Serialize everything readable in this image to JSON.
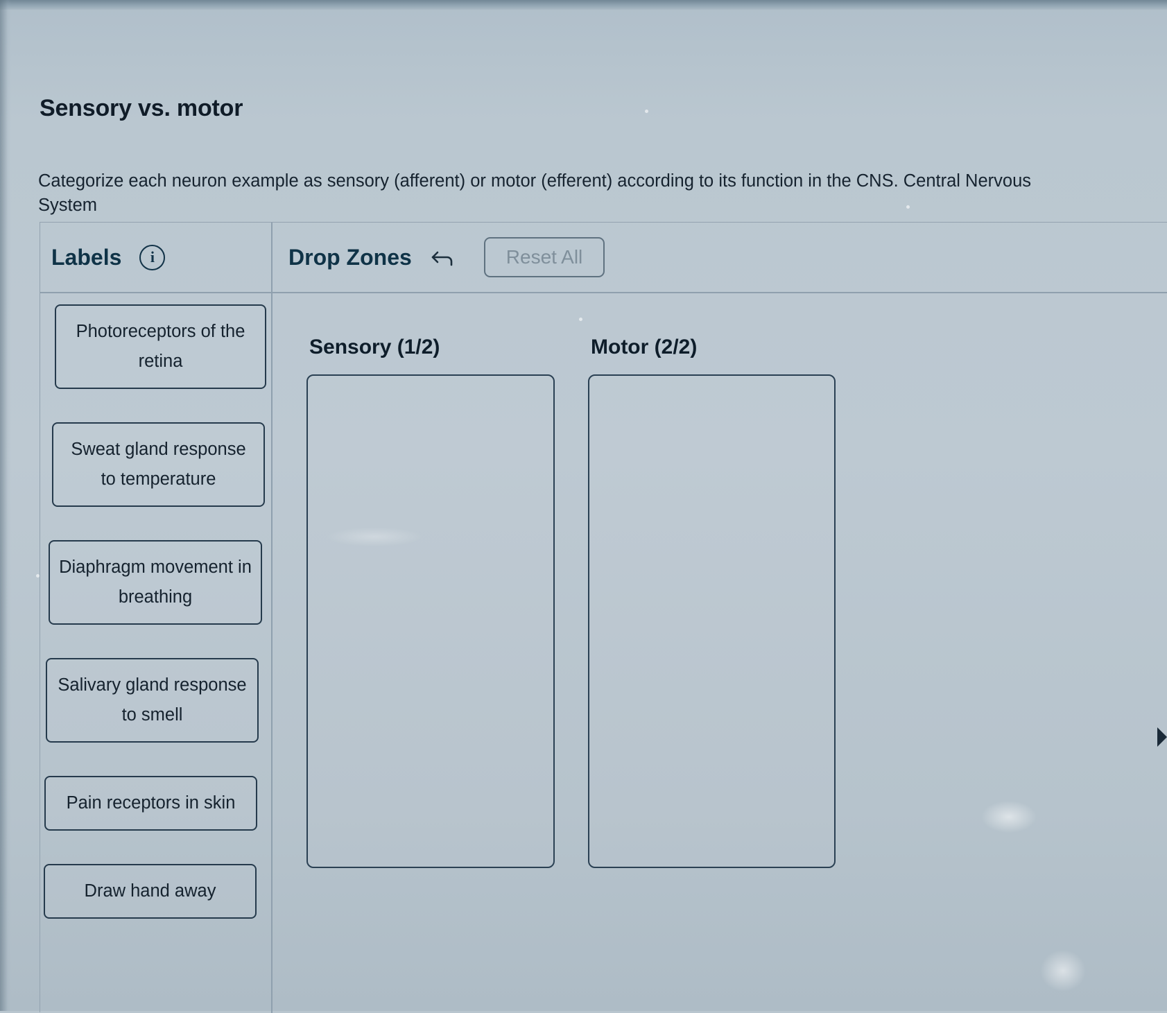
{
  "page": {
    "title": "Sensory vs. motor",
    "prompt": "Categorize each neuron example as sensory (afferent) or motor (efferent) according to its function in the CNS. Central Nervous System"
  },
  "labels_panel": {
    "heading": "Labels",
    "info_icon": "info-icon",
    "items": [
      {
        "text": "Photoreceptors of the retina"
      },
      {
        "text": "Sweat gland response to temperature"
      },
      {
        "text": "Diaphragm movement in breathing"
      },
      {
        "text": "Salivary gland response to smell"
      },
      {
        "text": "Pain receptors in skin"
      },
      {
        "text": "Draw hand away"
      }
    ]
  },
  "drop_zones_panel": {
    "heading": "Drop Zones",
    "undo_icon": "undo-arrow-icon",
    "reset_label": "Reset All",
    "zones": [
      {
        "title": "Sensory (1/2)",
        "placed": []
      },
      {
        "title": "Motor (2/2)",
        "placed": []
      }
    ]
  },
  "scroll_indicator": "chevron-right-icon",
  "colors": {
    "background": "#bac7d0",
    "heading_accent": "#0f3347",
    "text": "#16232f",
    "card_border": "#253a4c",
    "muted": "#7f8f9b"
  }
}
